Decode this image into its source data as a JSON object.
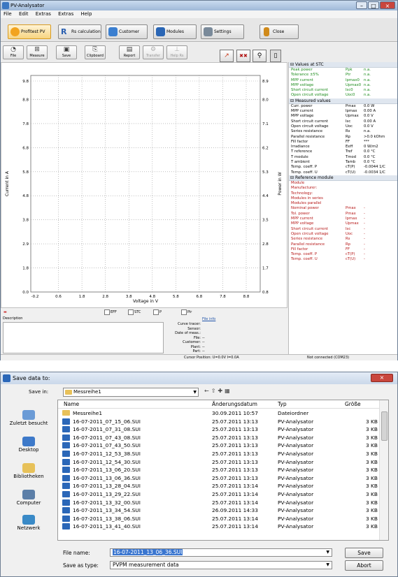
{
  "app": {
    "title": "PV-Analysator",
    "menu": [
      "File",
      "Edit",
      "Extras",
      "Extras",
      "Help"
    ],
    "nav": [
      {
        "label": "Profitest PV",
        "color": "#f2a41f"
      },
      {
        "label": "Rs calculation",
        "color": "#2a5fb0"
      },
      {
        "label": "Customer",
        "color": "#3b7fd0"
      },
      {
        "label": "Modules",
        "color": "#2a66b5"
      },
      {
        "label": "Settings",
        "color": "#7a8a9a"
      },
      {
        "label": "Close",
        "color": "#d08a1a"
      }
    ],
    "toolbar": [
      {
        "label": "File",
        "glyph": "◔",
        "enabled": true
      },
      {
        "label": "Measure",
        "glyph": "⊞",
        "enabled": true
      },
      {
        "label": "Save",
        "glyph": "▣",
        "enabled": true
      },
      {
        "label": "Clipboard",
        "glyph": "⎘",
        "enabled": true
      },
      {
        "label": "Report",
        "glyph": "▤",
        "enabled": true
      },
      {
        "label": "Transfer",
        "glyph": "⚙",
        "enabled": false
      },
      {
        "label": "Help Rs",
        "glyph": "⊥",
        "enabled": false
      }
    ],
    "chart_data": {
      "type": "line",
      "xlabel": "Voltage in V",
      "ylabel": "Current in A",
      "y2label": "Power in W",
      "x_ticks": [
        "-0.2",
        "0.6",
        "1.8",
        "2.8",
        "3.8",
        "4.8",
        "5.8",
        "6.8",
        "7.8",
        "8.8"
      ],
      "y_ticks": [
        "0.0",
        "1.8",
        "2.9",
        "3.8",
        "4.8",
        "5.8",
        "6.8",
        "7.8",
        "8.8",
        "9.8"
      ],
      "y2_ticks": [
        "0.8",
        "1.7",
        "2.8",
        "3.5",
        "4.4",
        "5.3",
        "6.2",
        "7.1",
        "8.0",
        "8.9"
      ],
      "series": [],
      "grid": true
    },
    "checkboxes": [
      "EFF",
      "STC",
      "P",
      "Pir"
    ],
    "description_label": "Description",
    "file_info": {
      "heading": "File info",
      "rows": [
        {
          "label": "Curve tracer:",
          "value": ""
        },
        {
          "label": "Sensor:",
          "value": ""
        },
        {
          "label": "Date of meas.:",
          "value": ""
        },
        {
          "label": "File:",
          "value": "--"
        },
        {
          "label": "Customer:",
          "value": "--"
        },
        {
          "label": "Plant:",
          "value": "--"
        },
        {
          "label": "Part:",
          "value": "--"
        }
      ]
    },
    "status": {
      "cursor": "Cursor Position: U=0.0V I=0.0A",
      "connection": "Not connected (COM23)"
    },
    "values_stc": {
      "heading": "Values at STC",
      "rows": [
        [
          "Peak power",
          "Ppk",
          "n.a."
        ],
        [
          "Tolerance ±5%",
          "Ptr",
          "n.a."
        ],
        [
          "MPP current",
          "Ipmax0",
          "n.a."
        ],
        [
          "MPP voltage",
          "Upmax0",
          "n.a."
        ],
        [
          "Short circuit current",
          "Isc0",
          "n.a."
        ],
        [
          "Open circuit voltage",
          "Uoc0",
          "n.a."
        ]
      ]
    },
    "measured": {
      "heading": "Measured values",
      "rows": [
        [
          "Curr. power",
          "Pmax",
          "0.0 W"
        ],
        [
          "MPP current",
          "Ipmax",
          "0.00 A"
        ],
        [
          "MPP voltage",
          "Upmax",
          "0.0 V"
        ],
        [
          "Short circuit current",
          "Isc",
          "0.00 A"
        ],
        [
          "Open circuit voltage",
          "Uoc",
          "0.0 V"
        ],
        [
          "Series resistance",
          "Rs",
          "n.a."
        ],
        [
          "Parallel resistance",
          "Rp",
          ">0.0 kOhm"
        ],
        [
          "Fill factor",
          "FF",
          "***"
        ],
        [
          "Irradiance",
          "Eeff",
          "0 W/m2"
        ],
        [
          "T reference",
          "Tref",
          "0.0 °C"
        ],
        [
          "T module",
          "Tmod",
          "0.0 °C"
        ],
        [
          "T ambient",
          "Tamb",
          "0.0 °C"
        ],
        [
          "Temp. coeff. P",
          "cT(P)",
          "-0.0044 1/C"
        ],
        [
          "Temp. coeff. U",
          "cT(U)",
          "-0.0034 1/C"
        ]
      ]
    },
    "reference": {
      "heading": "Reference module",
      "rows": [
        [
          "Module",
          "",
          ""
        ],
        [
          "Manufacturer:",
          "",
          ""
        ],
        [
          "Technology:",
          "",
          ""
        ],
        [
          "Modules in series",
          "",
          ""
        ],
        [
          "Modules parallel",
          "",
          ""
        ],
        [
          "Nominal power",
          "Pmax",
          "-"
        ],
        [
          "Tol. power",
          "Pmax",
          "-"
        ],
        [
          "MPP current",
          "Ipmax",
          "-"
        ],
        [
          "MPP voltage",
          "Upmax",
          "-"
        ],
        [
          "Short circuit current",
          "Isc",
          "-"
        ],
        [
          "Open circuit voltage",
          "Uoc",
          "-"
        ],
        [
          "Series resistance",
          "Rs",
          "-"
        ],
        [
          "Parallel resistance",
          "Rp",
          "-"
        ],
        [
          "Fill factor",
          "FF",
          "-"
        ],
        [
          "Temp. coeff. P",
          "cT(P)",
          "-"
        ],
        [
          "Temp. coeff. U",
          "cT(U)",
          "-"
        ]
      ]
    }
  },
  "dialog": {
    "title": "Save data to:",
    "save_in_label": "Save in:",
    "folder": "Messreihe1",
    "columns": [
      "Name",
      "Änderungsdatum",
      "Typ",
      "Größe"
    ],
    "places": [
      {
        "label": "Zuletzt besucht",
        "color": "#6b9bd6"
      },
      {
        "label": "Desktop",
        "color": "#3d79c9"
      },
      {
        "label": "Bibliotheken",
        "color": "#e7c159"
      },
      {
        "label": "Computer",
        "color": "#5c7fa8"
      },
      {
        "label": "Netzwerk",
        "color": "#3a8ac7"
      }
    ],
    "files": [
      {
        "name": "Messreihe1",
        "date": "30.09.2011 10:57",
        "type": "Dateiordner",
        "size": "",
        "folder": true
      },
      {
        "name": "16-07-2011_07_15_06.SUI",
        "date": "25.07.2011 13:13",
        "type": "PV-Analysator",
        "size": "3 KB"
      },
      {
        "name": "16-07-2011_07_31_08.SUI",
        "date": "25.07.2011 13:13",
        "type": "PV-Analysator",
        "size": "3 KB"
      },
      {
        "name": "16-07-2011_07_43_08.SUI",
        "date": "25.07.2011 13:13",
        "type": "PV-Analysator",
        "size": "3 KB"
      },
      {
        "name": "16-07-2011_07_43_50.SUI",
        "date": "25.07.2011 13:13",
        "type": "PV-Analysator",
        "size": "3 KB"
      },
      {
        "name": "16-07-2011_12_53_38.SUI",
        "date": "25.07.2011 13:13",
        "type": "PV-Analysator",
        "size": "3 KB"
      },
      {
        "name": "16-07-2011_12_54_30.SUI",
        "date": "25.07.2011 13:13",
        "type": "PV-Analysator",
        "size": "3 KB"
      },
      {
        "name": "16-07-2011_13_06_20.SUI",
        "date": "25.07.2011 13:13",
        "type": "PV-Analysator",
        "size": "3 KB"
      },
      {
        "name": "16-07-2011_13_06_36.SUI",
        "date": "25.07.2011 13:13",
        "type": "PV-Analysator",
        "size": "3 KB"
      },
      {
        "name": "16-07-2011_13_28_04.SUI",
        "date": "25.07.2011 13:14",
        "type": "PV-Analysator",
        "size": "3 KB"
      },
      {
        "name": "16-07-2011_13_29_22.SUI",
        "date": "25.07.2011 13:14",
        "type": "PV-Analysator",
        "size": "3 KB"
      },
      {
        "name": "16-07-2011_13_32_00.SUI",
        "date": "25.07.2011 13:14",
        "type": "PV-Analysator",
        "size": "3 KB"
      },
      {
        "name": "16-07-2011_13_34_54.SUI",
        "date": "26.09.2011 14:33",
        "type": "PV-Analysator",
        "size": "3 KB"
      },
      {
        "name": "16-07-2011_13_38_06.SUI",
        "date": "25.07.2011 13:14",
        "type": "PV-Analysator",
        "size": "3 KB"
      },
      {
        "name": "16-07-2011_13_41_40.SUI",
        "date": "25.07.2011 13:14",
        "type": "PV-Analysator",
        "size": "3 KB"
      }
    ],
    "file_name_label": "File name:",
    "file_name_value": "16-07-2011_13_06_36.SUI",
    "save_type_label": "Save as type:",
    "save_type_value": "PVPM measurement data",
    "save_button": "Save",
    "cancel_button": "Abort"
  }
}
